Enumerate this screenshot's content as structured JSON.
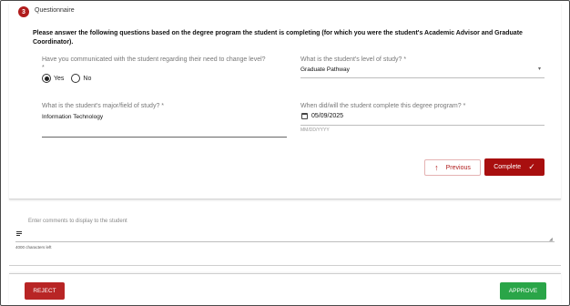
{
  "step": {
    "number": "3",
    "title": "Questionnaire"
  },
  "instructions": "Please answer the following questions based on the degree program the student is completing (for which you were the student's Academic Advisor and Graduate Coordinator).",
  "questions": {
    "communicated": {
      "label": "Have you communicated with the student regarding their need to change level?",
      "required_mark": "*",
      "options": [
        "Yes",
        "No"
      ],
      "selected": "Yes"
    },
    "level": {
      "label": "What is the student's level of study? *",
      "value": "Graduate Pathway"
    },
    "major": {
      "label": "What is the student's major/field of study? *",
      "value": "Information Technology"
    },
    "completion_date": {
      "label": "When did/will the student complete this degree program? *",
      "value": "05/09/2025",
      "hint": "MM/DD/YYYY"
    }
  },
  "buttons": {
    "previous": "Previous",
    "complete": "Complete",
    "reject": "REJECT",
    "approve": "APPROVE"
  },
  "comments": {
    "placeholder": "Enter comments to display to the student",
    "chars_left": "4000 characters left"
  },
  "colors": {
    "primary_red": "#a80f0f",
    "approve_green": "#2aa548"
  }
}
